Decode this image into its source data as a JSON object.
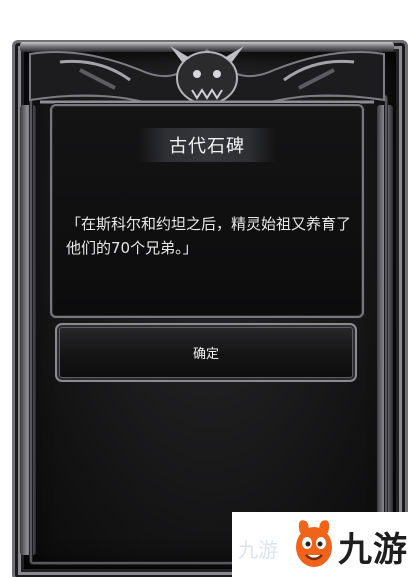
{
  "dialog": {
    "title": "古代石碑",
    "message": "「在斯科尔和约坦之后，精灵始祖又养育了他们的70个兄弟。」",
    "confirm_label": "确定"
  },
  "watermark": {
    "brand_text": "九游",
    "faint_text": "九游"
  },
  "colors": {
    "frame_metal": "#8a8a90",
    "panel_background": "#0c0c0d",
    "text": "#e8e8e8",
    "watermark_orange": "#f0631a"
  },
  "icons": {
    "crest": "demon-head-crest-icon",
    "mascot": "jiuyou-mascot-icon"
  }
}
